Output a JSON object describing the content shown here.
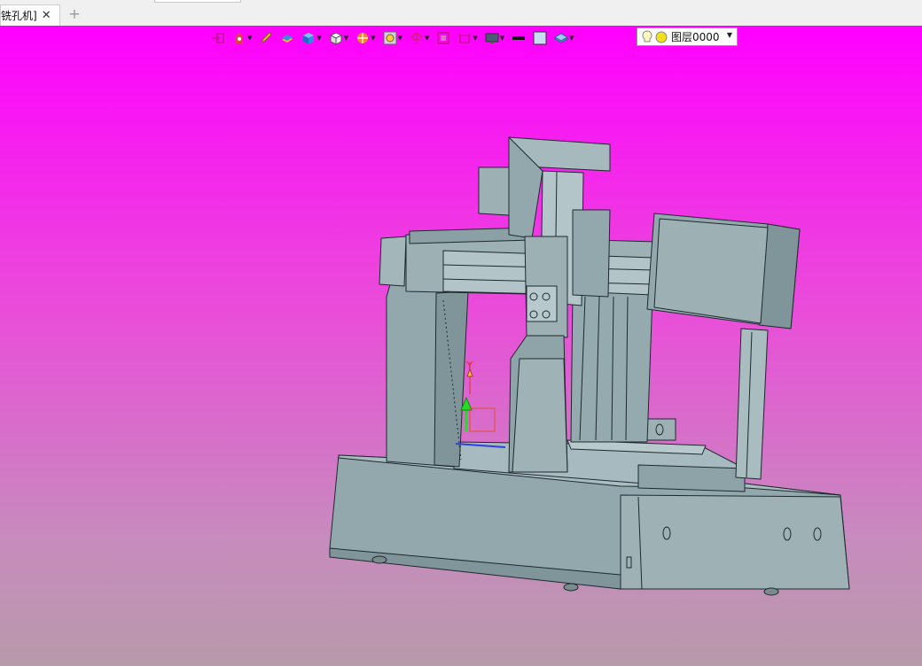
{
  "tabs": [
    {
      "label": "铣孔机]",
      "close_symbol": "✕"
    }
  ],
  "tab_add_symbol": "+",
  "toolbar": {
    "buttons": [
      {
        "name": "move-entity-icon"
      },
      {
        "name": "set-properties-icon"
      },
      {
        "name": "edit-pen-icon"
      },
      {
        "name": "color-entity-icon"
      },
      {
        "name": "solid-view-icon"
      },
      {
        "name": "view-cube-icon"
      },
      {
        "name": "render-style-icon"
      },
      {
        "name": "zoom-view-icon"
      },
      {
        "name": "rotate-view-icon"
      },
      {
        "name": "fit-view-icon"
      },
      {
        "name": "section-view-icon"
      },
      {
        "name": "display-monitor-icon"
      },
      {
        "name": "line-color-swatch-icon"
      },
      {
        "name": "fill-color-swatch-icon"
      },
      {
        "name": "layer-stack-icon"
      }
    ],
    "layer_label": "图层0000",
    "layer_dropdown_symbol": "▼"
  },
  "triad": {
    "y_axis_label": "Y"
  },
  "colors": {
    "background_top": "#ff00ff",
    "background_bottom": "#b79aaa",
    "model_face": "#93a8ad",
    "model_edge": "#1c2a2e",
    "axis_green": "#22dd22",
    "axis_red": "#e03030"
  }
}
